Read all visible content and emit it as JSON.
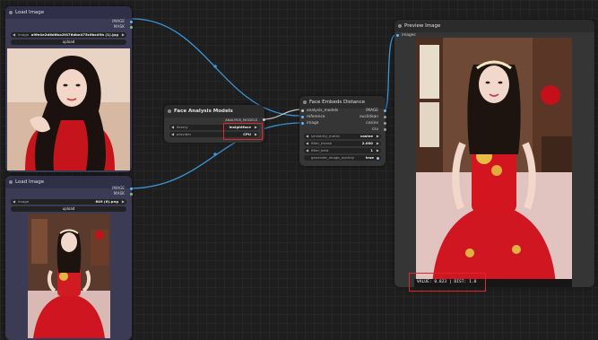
{
  "colors": {
    "image_link": "#3a94d6",
    "model_link": "#4a8fd0",
    "highlight": "#e0262d"
  },
  "load_image_top": {
    "title": "Load Image",
    "out_image": "IMAGE",
    "out_mask": "MASK",
    "image_label": "image",
    "image_value": "a9fe4e2d8d6ba2f476dbe475c6bc49b (1).jpg",
    "upload_label": "upload"
  },
  "load_image_bottom": {
    "title": "Load Image",
    "out_image": "IMAGE",
    "out_mask": "MASK",
    "image_label": "image",
    "image_value": "649 (6).png",
    "upload_label": "upload"
  },
  "face_analysis": {
    "title": "Face Analysis Models",
    "out_models": "ANALYSIS_MODELS",
    "library_label": "library",
    "library_value": "insightface",
    "provider_label": "provider",
    "provider_value": "CPU"
  },
  "face_distance": {
    "title": "Face Embeds Distance",
    "in_analysis": "analysis_models",
    "in_reference": "reference",
    "in_image": "image",
    "out_image": "IMAGE",
    "out_euclidean": "euclidean",
    "out_cosine": "cosine",
    "out_csv": "csv",
    "similarity_label": "similarity_metric",
    "similarity_value": "cosine",
    "threshold_label": "filter_thresh",
    "threshold_value": "2.000",
    "filter_best_label": "filter_best",
    "filter_best_value": "1",
    "overlay_label": "generate_image_overlay",
    "overlay_value": "true"
  },
  "preview_image": {
    "title": "Preview Image",
    "in_images": "images",
    "overlay_text": "VALUE: 0.823 | DIST: 1.0"
  }
}
